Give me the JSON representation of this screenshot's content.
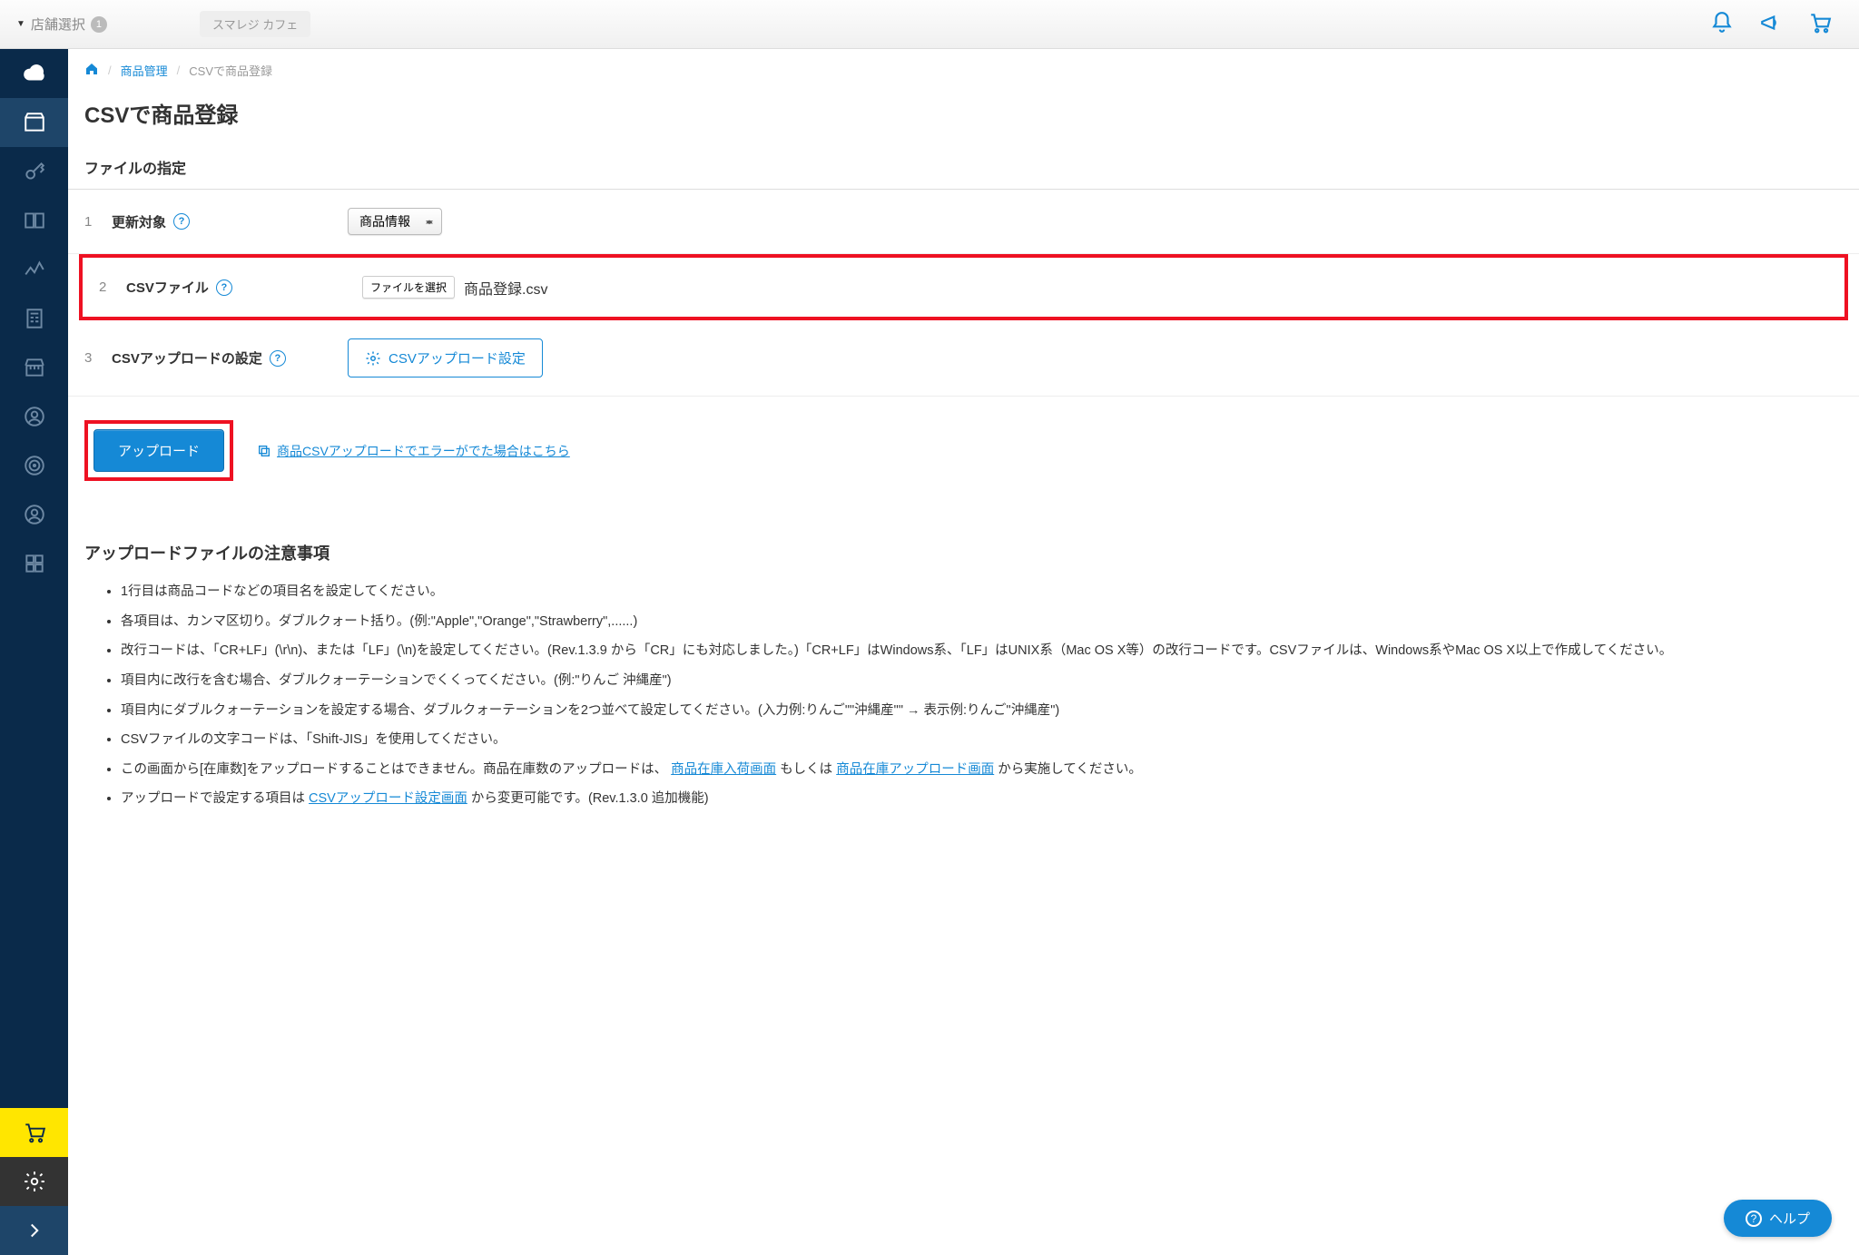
{
  "topbar": {
    "store_select_label": "店舗選択",
    "store_badge": "1",
    "store_tag": "スマレジ カフェ"
  },
  "breadcrumb": {
    "item1": "商品管理",
    "item2": "CSVで商品登録"
  },
  "page_title": "CSVで商品登録",
  "section_title": "ファイルの指定",
  "rows": {
    "r1": {
      "num": "1",
      "label": "更新対象",
      "select_value": "商品情報"
    },
    "r2": {
      "num": "2",
      "label": "CSVファイル",
      "file_button": "ファイルを選択",
      "file_name": "商品登録.csv"
    },
    "r3": {
      "num": "3",
      "label": "CSVアップロードの設定",
      "button": "CSVアップロード設定"
    }
  },
  "actions": {
    "upload": "アップロード",
    "error_link": "商品CSVアップロードでエラーがでた場合はこちら"
  },
  "notes": {
    "title": "アップロードファイルの注意事項",
    "li1": "1行目は商品コードなどの項目名を設定してください。",
    "li2": "各項目は、カンマ区切り。ダブルクォート括り。(例:\"Apple\",\"Orange\",\"Strawberry\",......)",
    "li3": "改行コードは、「CR+LF」(\\r\\n)、または「LF」(\\n)を設定してください。(Rev.1.3.9 から「CR」にも対応しました。)「CR+LF」はWindows系、「LF」はUNIX系（Mac OS X等）の改行コードです。CSVファイルは、Windows系やMac OS X以上で作成してください。",
    "li4": "項目内に改行を含む場合、ダブルクォーテーションでくくってください。(例:\"りんご 沖縄産\")",
    "li5": "項目内にダブルクォーテーションを設定する場合、ダブルクォーテーションを2つ並べて設定してください。(入力例:りんご\"\"沖縄産\"\" → 表示例:りんご\"沖縄産\")",
    "li6": "CSVファイルの文字コードは、「Shift-JIS」を使用してください。",
    "li7_a": "この画面から[在庫数]をアップロードすることはできません。商品在庫数のアップロードは、",
    "li7_link1": "商品在庫入荷画面",
    "li7_b": "もしくは",
    "li7_link2": "商品在庫アップロード画面",
    "li7_c": "から実施してください。",
    "li8_a": "アップロードで設定する項目は",
    "li8_link": "CSVアップロード設定画面",
    "li8_b": " から変更可能です。(Rev.1.3.0 追加機能)"
  },
  "help_pill": "ヘルプ"
}
